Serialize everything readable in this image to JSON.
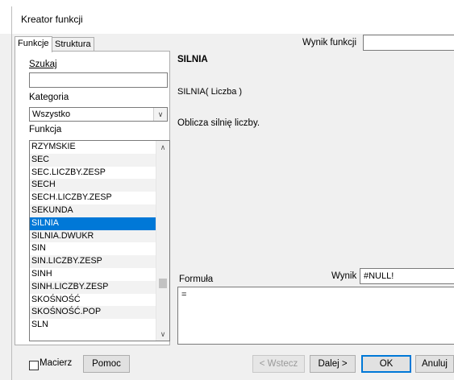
{
  "window": {
    "title": "Kreator funkcji"
  },
  "tabs": [
    {
      "label": "Funkcje",
      "active": true
    },
    {
      "label": "Struktura",
      "active": false
    }
  ],
  "search": {
    "label": "Szukaj",
    "value": ""
  },
  "category": {
    "label": "Kategoria",
    "selected": "Wszystko"
  },
  "function_list": {
    "label": "Funkcja",
    "items": [
      "RZYMSKIE",
      "SEC",
      "SEC.LICZBY.ZESP",
      "SECH",
      "SECH.LICZBY.ZESP",
      "SEKUNDA",
      "SILNIA",
      "SILNIA.DWUKR",
      "SIN",
      "SIN.LICZBY.ZESP",
      "SINH",
      "SINH.LICZBY.ZESP",
      "SKOŚNOŚĆ",
      "SKOŚNOŚĆ.POP",
      "SLN"
    ],
    "selected": "SILNIA"
  },
  "function_result": {
    "label": "Wynik funkcji",
    "value": ""
  },
  "details": {
    "name": "SILNIA",
    "signature": "SILNIA( Liczba )",
    "description": "Oblicza silnię liczby."
  },
  "formula": {
    "label": "Formuła",
    "value": "="
  },
  "result": {
    "label": "Wynik",
    "value": "#NULL!"
  },
  "footer": {
    "array_label": "Macierz",
    "array_checked": false,
    "help_label": "Pomoc",
    "back_label": "< Wstecz",
    "next_label": "Dalej >",
    "ok_label": "OK",
    "cancel_label": "Anuluj"
  },
  "colors": {
    "selection": "#0078d7",
    "background": "#f0f0f0"
  },
  "icons": {
    "combo_arrow": "chevron-down-icon",
    "scroll_up": "chevron-up-icon",
    "scroll_down": "chevron-down-icon"
  }
}
